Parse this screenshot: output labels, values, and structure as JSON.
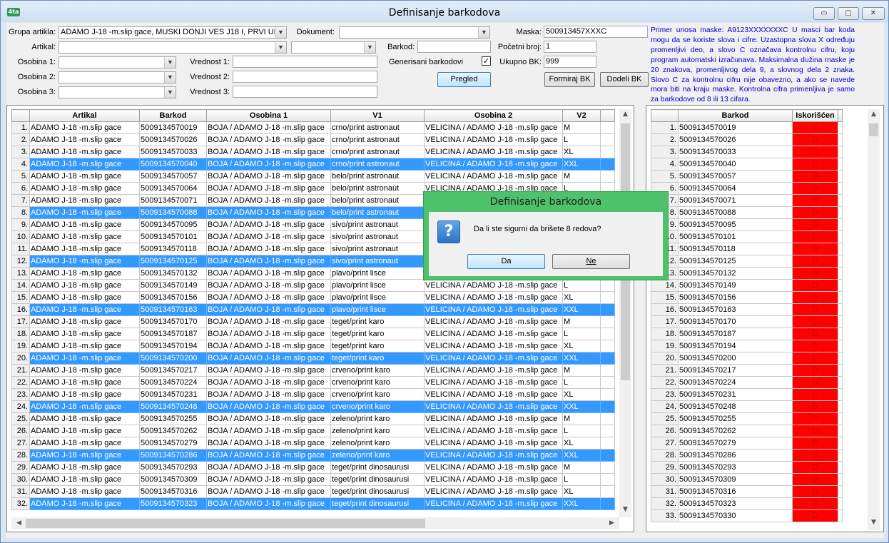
{
  "window": {
    "title": "Definisanje barkodova",
    "icon_text": "4ta",
    "buttons": {
      "minimize": "▭",
      "maximize": "▢",
      "close": "✕"
    }
  },
  "form": {
    "grupa_label": "Grupa artikla:",
    "grupa_value": "ADAMO J-18 -m.slip gace, MUSKI DONJI VES J18 I, PRVI ULAZ",
    "dokument_label": "Dokument:",
    "dokument_value": "",
    "artikal_label": "Artikal:",
    "artikal_value": "",
    "artikal2_value": "",
    "osobina1_label": "Osobina 1:",
    "osobina2_label": "Osobina 2:",
    "osobina3_label": "Osobina 3:",
    "vrednost1_label": "Vrednost 1:",
    "vrednost2_label": "Vrednost 2:",
    "vrednost3_label": "Vrednost 3:",
    "barkod_label": "Barkod:",
    "barkod_value": "",
    "generisani_label": "Generisani barkodovi",
    "generisani_checked": "✓",
    "maska_label": "Maska:",
    "maska_value": "500913457XXXC",
    "pocetni_label": "Početni broj:",
    "pocetni_value": "1",
    "ukupno_label": "Ukupno BK:",
    "ukupno_value": "999",
    "pregled_button": "Pregled",
    "formiraj_button": "Formiraj BK",
    "dodeli_button": "Dodeli BK",
    "help_text": "Primer unosa maske: A9123XXXXXXXC U masci bar koda mogu da se koriste slova i cifre. Uzastopna slova X određuju promenljivi deo, a slovo C označava kontrolnu cifru, koju program automatski izračunava. Maksimalna dužina maske je 20 znakova, promenljivog dela 9, a slovnog dela 2 znaka. Slovo C za kontrolnu cifru nije obavezno, a ako se navede mora biti na kraju maske. Kontrolna cifra primenljiva je samo za barkodove od 8 ili 13 cifara."
  },
  "main_table": {
    "columns": [
      "Artikal",
      "Barkod",
      "Osobina 1",
      "V1",
      "Osobina 2",
      "V2"
    ],
    "rows": [
      {
        "n": "1.",
        "artikal": "ADAMO J-18 -m.slip gace",
        "barkod": "5009134570019",
        "os1": "BOJA / ADAMO J-18 -m.slip gace",
        "v1": "crno/print astronaut",
        "os2": "VELICINA / ADAMO J-18 -m.slip gace",
        "v2": "M",
        "sel": false
      },
      {
        "n": "2.",
        "artikal": "ADAMO J-18 -m.slip gace",
        "barkod": "5009134570026",
        "os1": "BOJA / ADAMO J-18 -m.slip gace",
        "v1": "crno/print astronaut",
        "os2": "VELICINA / ADAMO J-18 -m.slip gace",
        "v2": "L",
        "sel": false
      },
      {
        "n": "3.",
        "artikal": "ADAMO J-18 -m.slip gace",
        "barkod": "5009134570033",
        "os1": "BOJA / ADAMO J-18 -m.slip gace",
        "v1": "crno/print astronaut",
        "os2": "VELICINA / ADAMO J-18 -m.slip gace",
        "v2": "XL",
        "sel": false
      },
      {
        "n": "4.",
        "artikal": "ADAMO J-18 -m.slip gace",
        "barkod": "5009134570040",
        "os1": "BOJA / ADAMO J-18 -m.slip gace",
        "v1": "crno/print astronaut",
        "os2": "VELICINA / ADAMO J-18 -m.slip gace",
        "v2": "XXL",
        "sel": true
      },
      {
        "n": "5.",
        "artikal": "ADAMO J-18 -m.slip gace",
        "barkod": "5009134570057",
        "os1": "BOJA / ADAMO J-18 -m.slip gace",
        "v1": "belo/print astronaut",
        "os2": "VELICINA / ADAMO J-18 -m.slip gace",
        "v2": "M",
        "sel": false
      },
      {
        "n": "6.",
        "artikal": "ADAMO J-18 -m.slip gace",
        "barkod": "5009134570064",
        "os1": "BOJA / ADAMO J-18 -m.slip gace",
        "v1": "belo/print astronaut",
        "os2": "VELICINA / ADAMO J-18 -m.slip gace",
        "v2": "L",
        "sel": false
      },
      {
        "n": "7.",
        "artikal": "ADAMO J-18 -m.slip gace",
        "barkod": "5009134570071",
        "os1": "BOJA / ADAMO J-18 -m.slip gace",
        "v1": "belo/print astronaut",
        "os2": "",
        "v2": "",
        "sel": false
      },
      {
        "n": "8.",
        "artikal": "ADAMO J-18 -m.slip gace",
        "barkod": "5009134570088",
        "os1": "BOJA / ADAMO J-18 -m.slip gace",
        "v1": "belo/print astronaut",
        "os2": "",
        "v2": "",
        "sel": true
      },
      {
        "n": "9.",
        "artikal": "ADAMO J-18 -m.slip gace",
        "barkod": "5009134570095",
        "os1": "BOJA / ADAMO J-18 -m.slip gace",
        "v1": "sivo/print astronaut",
        "os2": "",
        "v2": "",
        "sel": false
      },
      {
        "n": "10.",
        "artikal": "ADAMO J-18 -m.slip gace",
        "barkod": "5009134570101",
        "os1": "BOJA / ADAMO J-18 -m.slip gace",
        "v1": "sivo/print astronaut",
        "os2": "",
        "v2": "",
        "sel": false
      },
      {
        "n": "11.",
        "artikal": "ADAMO J-18 -m.slip gace",
        "barkod": "5009134570118",
        "os1": "BOJA / ADAMO J-18 -m.slip gace",
        "v1": "sivo/print astronaut",
        "os2": "",
        "v2": "",
        "sel": false
      },
      {
        "n": "12.",
        "artikal": "ADAMO J-18 -m.slip gace",
        "barkod": "5009134570125",
        "os1": "BOJA / ADAMO J-18 -m.slip gace",
        "v1": "sivo/print astronaut",
        "os2": "",
        "v2": "",
        "sel": true
      },
      {
        "n": "13.",
        "artikal": "ADAMO J-18 -m.slip gace",
        "barkod": "5009134570132",
        "os1": "BOJA / ADAMO J-18 -m.slip gace",
        "v1": "plavo/print lisce",
        "os2": "VELICINA / ADAMO J-18 -m.slip gace",
        "v2": "M",
        "sel": false
      },
      {
        "n": "14.",
        "artikal": "ADAMO J-18 -m.slip gace",
        "barkod": "5009134570149",
        "os1": "BOJA / ADAMO J-18 -m.slip gace",
        "v1": "plavo/print lisce",
        "os2": "VELICINA / ADAMO J-18 -m.slip gace",
        "v2": "L",
        "sel": false
      },
      {
        "n": "15.",
        "artikal": "ADAMO J-18 -m.slip gace",
        "barkod": "5009134570156",
        "os1": "BOJA / ADAMO J-18 -m.slip gace",
        "v1": "plavo/print lisce",
        "os2": "VELICINA / ADAMO J-18 -m.slip gace",
        "v2": "XL",
        "sel": false
      },
      {
        "n": "16.",
        "artikal": "ADAMO J-18 -m.slip gace",
        "barkod": "5009134570163",
        "os1": "BOJA / ADAMO J-18 -m.slip gace",
        "v1": "plavo/print lisce",
        "os2": "VELICINA / ADAMO J-18 -m.slip gace",
        "v2": "XXL",
        "sel": true
      },
      {
        "n": "17.",
        "artikal": "ADAMO J-18 -m.slip gace",
        "barkod": "5009134570170",
        "os1": "BOJA / ADAMO J-18 -m.slip gace",
        "v1": "teget/print karo",
        "os2": "VELICINA / ADAMO J-18 -m.slip gace",
        "v2": "M",
        "sel": false
      },
      {
        "n": "18.",
        "artikal": "ADAMO J-18 -m.slip gace",
        "barkod": "5009134570187",
        "os1": "BOJA / ADAMO J-18 -m.slip gace",
        "v1": "teget/print karo",
        "os2": "VELICINA / ADAMO J-18 -m.slip gace",
        "v2": "L",
        "sel": false
      },
      {
        "n": "19.",
        "artikal": "ADAMO J-18 -m.slip gace",
        "barkod": "5009134570194",
        "os1": "BOJA / ADAMO J-18 -m.slip gace",
        "v1": "teget/print karo",
        "os2": "VELICINA / ADAMO J-18 -m.slip gace",
        "v2": "XL",
        "sel": false
      },
      {
        "n": "20.",
        "artikal": "ADAMO J-18 -m.slip gace",
        "barkod": "5009134570200",
        "os1": "BOJA / ADAMO J-18 -m.slip gace",
        "v1": "teget/print karo",
        "os2": "VELICINA / ADAMO J-18 -m.slip gace",
        "v2": "XXL",
        "sel": true
      },
      {
        "n": "21.",
        "artikal": "ADAMO J-18 -m.slip gace",
        "barkod": "5009134570217",
        "os1": "BOJA / ADAMO J-18 -m.slip gace",
        "v1": "crveno/print karo",
        "os2": "VELICINA / ADAMO J-18 -m.slip gace",
        "v2": "M",
        "sel": false
      },
      {
        "n": "22.",
        "artikal": "ADAMO J-18 -m.slip gace",
        "barkod": "5009134570224",
        "os1": "BOJA / ADAMO J-18 -m.slip gace",
        "v1": "crveno/print karo",
        "os2": "VELICINA / ADAMO J-18 -m.slip gace",
        "v2": "L",
        "sel": false
      },
      {
        "n": "23.",
        "artikal": "ADAMO J-18 -m.slip gace",
        "barkod": "5009134570231",
        "os1": "BOJA / ADAMO J-18 -m.slip gace",
        "v1": "crveno/print karo",
        "os2": "VELICINA / ADAMO J-18 -m.slip gace",
        "v2": "XL",
        "sel": false
      },
      {
        "n": "24.",
        "artikal": "ADAMO J-18 -m.slip gace",
        "barkod": "5009134570248",
        "os1": "BOJA / ADAMO J-18 -m.slip gace",
        "v1": "crveno/print karo",
        "os2": "VELICINA / ADAMO J-18 -m.slip gace",
        "v2": "XXL",
        "sel": true
      },
      {
        "n": "25.",
        "artikal": "ADAMO J-18 -m.slip gace",
        "barkod": "5009134570255",
        "os1": "BOJA / ADAMO J-18 -m.slip gace",
        "v1": "zeleno/print karo",
        "os2": "VELICINA / ADAMO J-18 -m.slip gace",
        "v2": "M",
        "sel": false
      },
      {
        "n": "26.",
        "artikal": "ADAMO J-18 -m.slip gace",
        "barkod": "5009134570262",
        "os1": "BOJA / ADAMO J-18 -m.slip gace",
        "v1": "zeleno/print karo",
        "os2": "VELICINA / ADAMO J-18 -m.slip gace",
        "v2": "L",
        "sel": false
      },
      {
        "n": "27.",
        "artikal": "ADAMO J-18 -m.slip gace",
        "barkod": "5009134570279",
        "os1": "BOJA / ADAMO J-18 -m.slip gace",
        "v1": "zeleno/print karo",
        "os2": "VELICINA / ADAMO J-18 -m.slip gace",
        "v2": "XL",
        "sel": false
      },
      {
        "n": "28.",
        "artikal": "ADAMO J-18 -m.slip gace",
        "barkod": "5009134570286",
        "os1": "BOJA / ADAMO J-18 -m.slip gace",
        "v1": "zeleno/print karo",
        "os2": "VELICINA / ADAMO J-18 -m.slip gace",
        "v2": "XXL",
        "sel": true
      },
      {
        "n": "29.",
        "artikal": "ADAMO J-18 -m.slip gace",
        "barkod": "5009134570293",
        "os1": "BOJA / ADAMO J-18 -m.slip gace",
        "v1": "teget/print dinosaurusi",
        "os2": "VELICINA / ADAMO J-18 -m.slip gace",
        "v2": "M",
        "sel": false
      },
      {
        "n": "30.",
        "artikal": "ADAMO J-18 -m.slip gace",
        "barkod": "5009134570309",
        "os1": "BOJA / ADAMO J-18 -m.slip gace",
        "v1": "teget/print dinosaurusi",
        "os2": "VELICINA / ADAMO J-18 -m.slip gace",
        "v2": "L",
        "sel": false
      },
      {
        "n": "31.",
        "artikal": "ADAMO J-18 -m.slip gace",
        "barkod": "5009134570316",
        "os1": "BOJA / ADAMO J-18 -m.slip gace",
        "v1": "teget/print dinosaurusi",
        "os2": "VELICINA / ADAMO J-18 -m.slip gace",
        "v2": "XL",
        "sel": false
      },
      {
        "n": "32.",
        "artikal": "ADAMO J-18 -m.slip gace",
        "barkod": "5009134570323",
        "os1": "BOJA / ADAMO J-18 -m.slip gace",
        "v1": "teget/print dinosaurusi",
        "os2": "VELICINA / ADAMO J-18 -m.slip gace",
        "v2": "XXL",
        "sel": true
      }
    ]
  },
  "right_table": {
    "columns": [
      "Barkod",
      "Iskorišćen"
    ],
    "rows": [
      {
        "n": "1.",
        "barkod": "5009134570019",
        "flag": "D"
      },
      {
        "n": "2.",
        "barkod": "5009134570026",
        "flag": "D"
      },
      {
        "n": "3.",
        "barkod": "5009134570033",
        "flag": "D"
      },
      {
        "n": "4.",
        "barkod": "5009134570040",
        "flag": "D"
      },
      {
        "n": "5.",
        "barkod": "5009134570057",
        "flag": "D"
      },
      {
        "n": "6.",
        "barkod": "5009134570064",
        "flag": "D"
      },
      {
        "n": "7.",
        "barkod": "5009134570071",
        "flag": "D"
      },
      {
        "n": "8.",
        "barkod": "5009134570088",
        "flag": "D"
      },
      {
        "n": "9.",
        "barkod": "5009134570095",
        "flag": "D"
      },
      {
        "n": "10.",
        "barkod": "5009134570101",
        "flag": "D"
      },
      {
        "n": "11.",
        "barkod": "5009134570118",
        "flag": "D"
      },
      {
        "n": "12.",
        "barkod": "5009134570125",
        "flag": "D"
      },
      {
        "n": "13.",
        "barkod": "5009134570132",
        "flag": "D"
      },
      {
        "n": "14.",
        "barkod": "5009134570149",
        "flag": "D"
      },
      {
        "n": "15.",
        "barkod": "5009134570156",
        "flag": "D"
      },
      {
        "n": "16.",
        "barkod": "5009134570163",
        "flag": "D"
      },
      {
        "n": "17.",
        "barkod": "5009134570170",
        "flag": "D"
      },
      {
        "n": "18.",
        "barkod": "5009134570187",
        "flag": "D"
      },
      {
        "n": "19.",
        "barkod": "5009134570194",
        "flag": "D"
      },
      {
        "n": "20.",
        "barkod": "5009134570200",
        "flag": "D"
      },
      {
        "n": "21.",
        "barkod": "5009134570217",
        "flag": "D"
      },
      {
        "n": "22.",
        "barkod": "5009134570224",
        "flag": "D"
      },
      {
        "n": "23.",
        "barkod": "5009134570231",
        "flag": "D"
      },
      {
        "n": "24.",
        "barkod": "5009134570248",
        "flag": "D"
      },
      {
        "n": "25.",
        "barkod": "5009134570255",
        "flag": "D"
      },
      {
        "n": "26.",
        "barkod": "5009134570262",
        "flag": "D"
      },
      {
        "n": "27.",
        "barkod": "5009134570279",
        "flag": "D"
      },
      {
        "n": "28.",
        "barkod": "5009134570286",
        "flag": "D"
      },
      {
        "n": "29.",
        "barkod": "5009134570293",
        "flag": "D"
      },
      {
        "n": "30.",
        "barkod": "5009134570309",
        "flag": "D"
      },
      {
        "n": "31.",
        "barkod": "5009134570316",
        "flag": "D"
      },
      {
        "n": "32.",
        "barkod": "5009134570323",
        "flag": "D"
      },
      {
        "n": "33.",
        "barkod": "5009134570330",
        "flag": "D"
      }
    ]
  },
  "dialog": {
    "title": "Definisanje barkodova",
    "icon": "question-icon",
    "icon_glyph": "?",
    "message": "Da li ste sigurni da brišete 8 redova?",
    "yes_label": "Da",
    "no_label": "Ne"
  },
  "colors": {
    "selection": "#3399ff",
    "flag_red": "#ff0000",
    "dialog_frame": "#4dc26a",
    "help_text": "#0000cc"
  }
}
